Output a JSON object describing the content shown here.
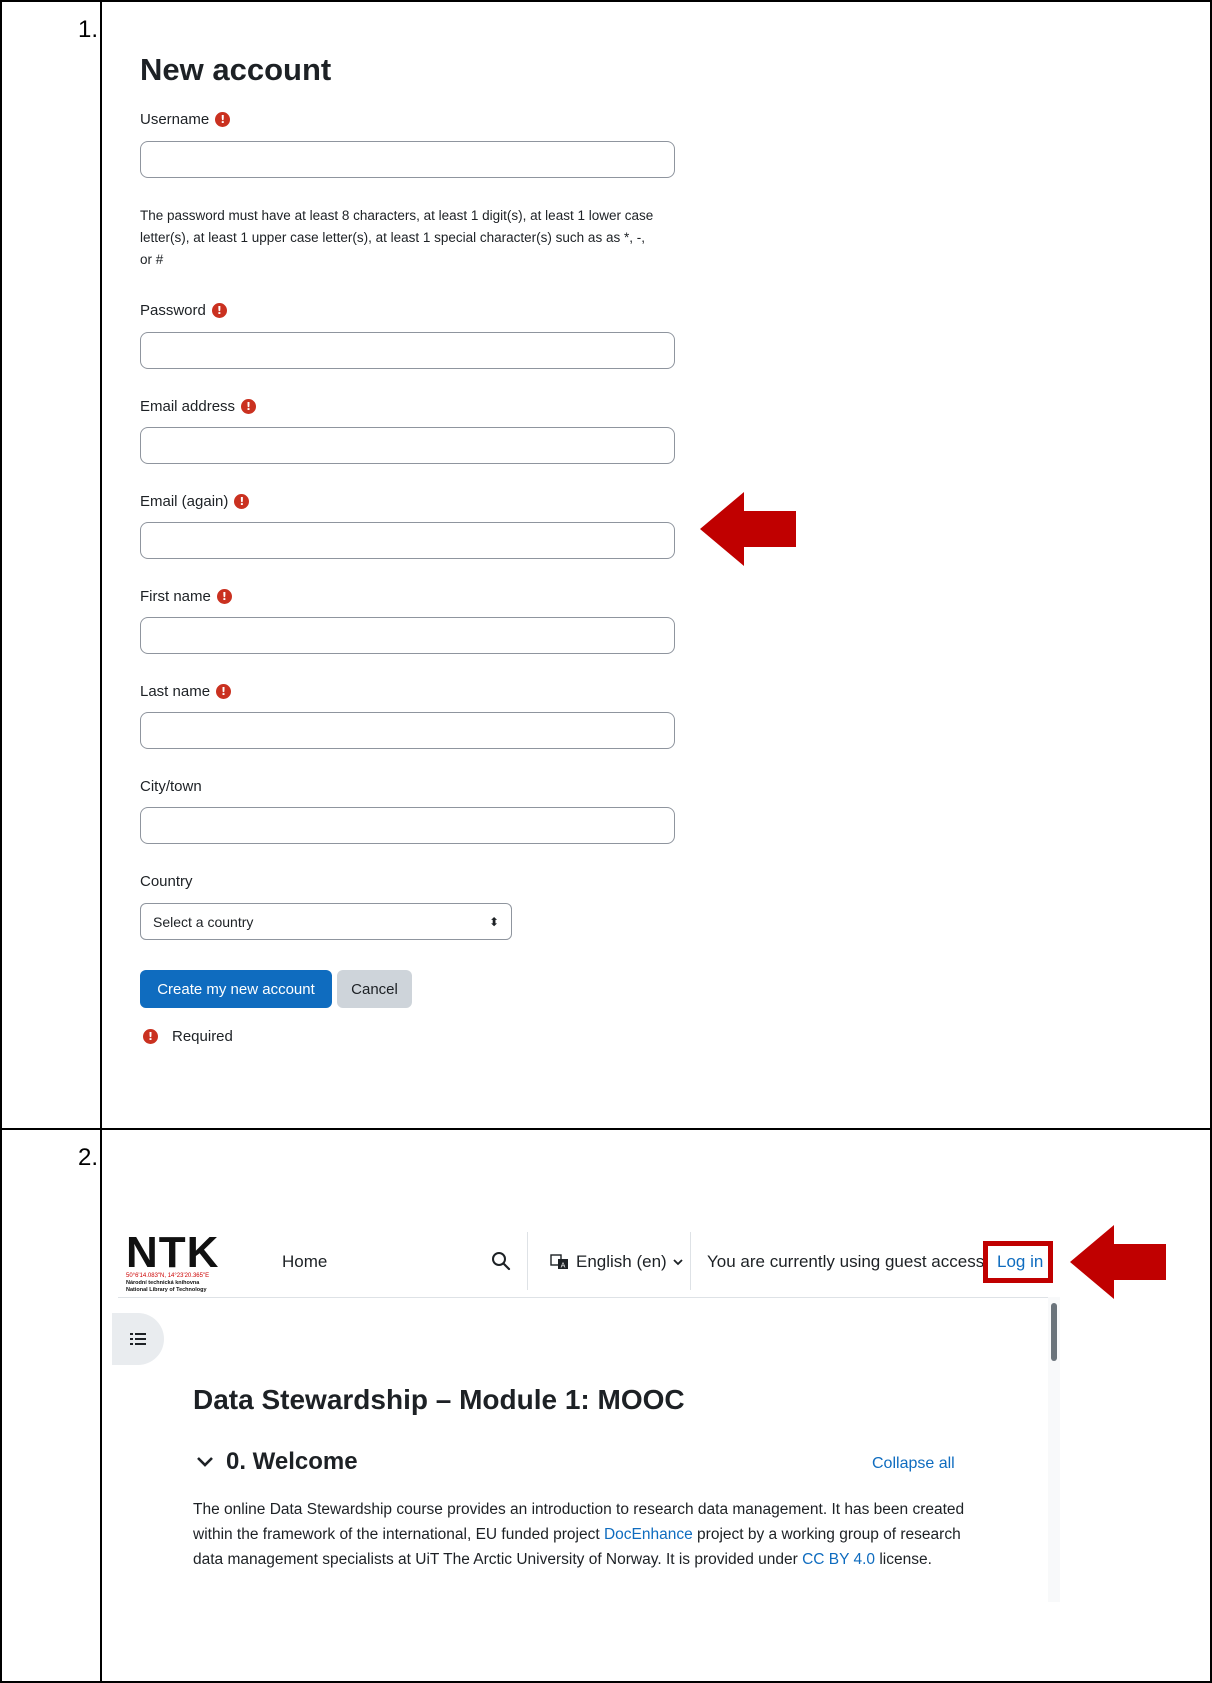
{
  "row1": {
    "number": "1.",
    "form": {
      "title": "New account",
      "fields": [
        {
          "label": "Username",
          "required": true,
          "value": ""
        },
        {
          "label": "Password",
          "required": true,
          "value": ""
        },
        {
          "label": "Email address",
          "required": true,
          "value": ""
        },
        {
          "label": "Email (again)",
          "required": true,
          "value": ""
        },
        {
          "label": "First name",
          "required": true,
          "value": ""
        },
        {
          "label": "Last name",
          "required": true,
          "value": ""
        },
        {
          "label": "City/town",
          "required": false,
          "value": ""
        }
      ],
      "password_help": "The password must have at least 8 characters, at least 1 digit(s), at least 1 lower case letter(s), at least 1 upper case letter(s), at least 1 special character(s) such as as *, -, or #",
      "country_label": "Country",
      "country_selected": "Select a country",
      "create_button": "Create my new account",
      "cancel_button": "Cancel",
      "required_legend": "Required",
      "required_icon_glyph": "!"
    }
  },
  "row2": {
    "number": "2.",
    "header": {
      "logo_text": "NTK",
      "logo_coord": "50°6'14.083\"N, 14°23'20.365\"E",
      "logo_sub1": "Národní technická knihovna",
      "logo_sub2": "National Library of Technology",
      "nav_home": "Home",
      "language": "English (en)",
      "guest_notice": "You are currently using guest access",
      "login": "Log in"
    },
    "course": {
      "title": "Data Stewardship – Module 1: MOOC",
      "section_title": "0. Welcome",
      "collapse_all": "Collapse all",
      "summary_part1": "The online Data Stewardship course provides an introduction to research data management. It has been created within the framework of the international, EU funded project ",
      "summary_link1": "DocEnhance",
      "summary_part2": " project by a working group of research data management specialists at UiT The Arctic University of Norway. It is provided under ",
      "summary_link2": "CC BY 4.0",
      "summary_part3": " license."
    }
  },
  "colors": {
    "primary": "#0f6cbf",
    "required": "#ca3120",
    "highlight": "#c00000"
  }
}
